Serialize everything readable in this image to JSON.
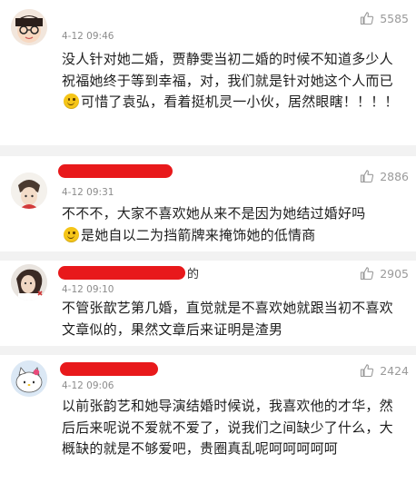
{
  "comments": [
    {
      "date": "4-12 09:46",
      "likes": "5585",
      "text": "没人针对她二婚，贾静雯当初二婚的时候不知道多少人祝福她终于等到幸福，对，我们就是针对她这个人而已",
      "text_after_emoji": "可惜了袁弘，看着挺机灵一小伙，居然眼瞎！！！！"
    },
    {
      "date": "4-12 09:31",
      "likes": "2886",
      "text": "不不不，大家不喜欢她从来不是因为她结过婚好吗",
      "text_after_emoji": "是她自以二为挡箭牌来掩饰她的低情商"
    },
    {
      "date": "4-12 09:10",
      "likes": "2905",
      "name_tail": "的",
      "text": "不管张歆艺第几婚，直觉就是不喜欢她就跟当初不喜欢文章似的，果然文章后来证明是渣男"
    },
    {
      "date": "4-12 09:06",
      "likes": "2424",
      "text": "以前张韵艺和她导演结婚时候说，我喜欢他的才华，然后后来呢说不爱就不爱了，说我们之间缺少了什么，大概缺的就是不够爱吧，贵圈真乱呢呵呵呵呵呵"
    }
  ],
  "colors": {
    "redaction": "#e8191b",
    "meta": "#8c8c8c",
    "separator": "#f2f2f2"
  },
  "icons": [
    "thumb-up-icon",
    "smile-emoji-icon"
  ]
}
